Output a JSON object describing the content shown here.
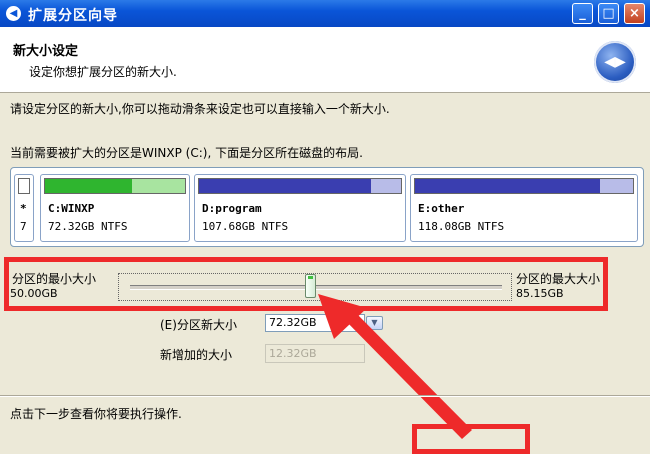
{
  "window": {
    "title": "扩展分区向导",
    "buttons": {
      "minimize": "_",
      "maximize": "□",
      "close": "×"
    }
  },
  "header": {
    "title": "新大小设定",
    "subtitle": "设定你想扩展分区的新大小.",
    "logo_icon": "wizard-arrows-icon"
  },
  "instructions": {
    "line1": "请设定分区的新大小,你可以拖动滑条来设定也可以直接输入一个新大小.",
    "line2": "当前需要被扩大的分区是WINXP (C:), 下面是分区所在磁盘的布局."
  },
  "disk_map": {
    "partitions": [
      {
        "name": "*",
        "size": "7",
        "used_fraction": 0.0
      },
      {
        "name": "C:WINXP",
        "size": "72.32GB NTFS",
        "used_fraction": 0.62
      },
      {
        "name": "D:program",
        "size": "107.68GB NTFS",
        "used_fraction": 0.85
      },
      {
        "name": "E:other",
        "size": "118.08GB NTFS",
        "used_fraction": 0.85
      }
    ],
    "colors": {
      "system_fill": "#2fb52f",
      "system_free": "#a8e4a0",
      "data_fill": "#3a3eb0",
      "data_free": "#b8bce8"
    }
  },
  "slider": {
    "min_label": "分区的最小大小",
    "min_value": "50.00GB",
    "max_label": "分区的最大大小",
    "max_value": "85.15GB",
    "position_fraction": 0.5
  },
  "fields": {
    "new_size_label": "(E)分区新大小",
    "new_size_value": "72.32GB",
    "added_size_label": "新增加的大小",
    "added_size_value": "12.32GB"
  },
  "footer": {
    "hint": "点击下一步查看你将要执行操作."
  },
  "annotation_color": "#ee2a2a"
}
